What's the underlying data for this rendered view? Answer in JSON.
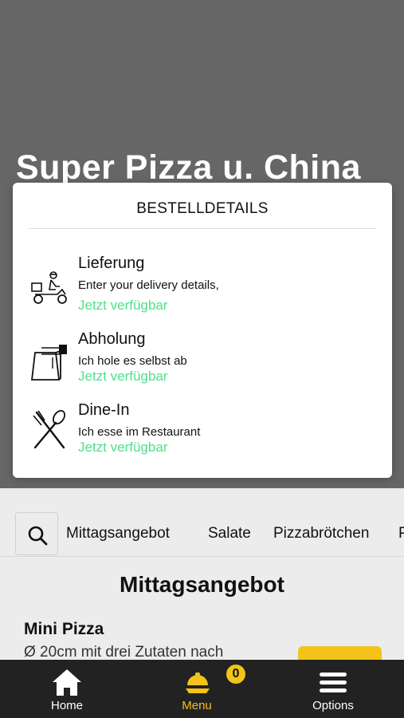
{
  "restaurant": {
    "name": "Super Pizza u. China"
  },
  "modal": {
    "title": "BESTELLDETAILS",
    "options": [
      {
        "icon": "delivery-scooter-icon",
        "title": "Lieferung",
        "description": "Enter your delivery details,",
        "status": "Jetzt verfügbar"
      },
      {
        "icon": "takeaway-bag-icon",
        "title": "Abholung",
        "description": "Ich hole es selbst ab",
        "status": "Jetzt verfügbar"
      },
      {
        "icon": "fork-spoon-icon",
        "title": "Dine-In",
        "description": "Ich esse im Restaurant",
        "status": "Jetzt verfügbar"
      }
    ]
  },
  "categories": [
    "Mittagsangebot",
    "Salate",
    "Pizzabrötchen",
    "P"
  ],
  "menu": {
    "section_title": "Mittagsangebot",
    "first_item": {
      "name": "Mini Pizza",
      "description": "Ø 20cm mit drei Zutaten nach"
    }
  },
  "nav": {
    "items": [
      {
        "label": "Home",
        "icon": "home-icon"
      },
      {
        "label": "Menu",
        "icon": "menu-cloche-icon",
        "badge": "0"
      },
      {
        "label": "Options",
        "icon": "hamburger-menu-icon"
      }
    ]
  },
  "colors": {
    "accent": "#f3c319",
    "available": "#4fe08a",
    "nav_bg": "#222222",
    "hero_bg": "#666666"
  }
}
